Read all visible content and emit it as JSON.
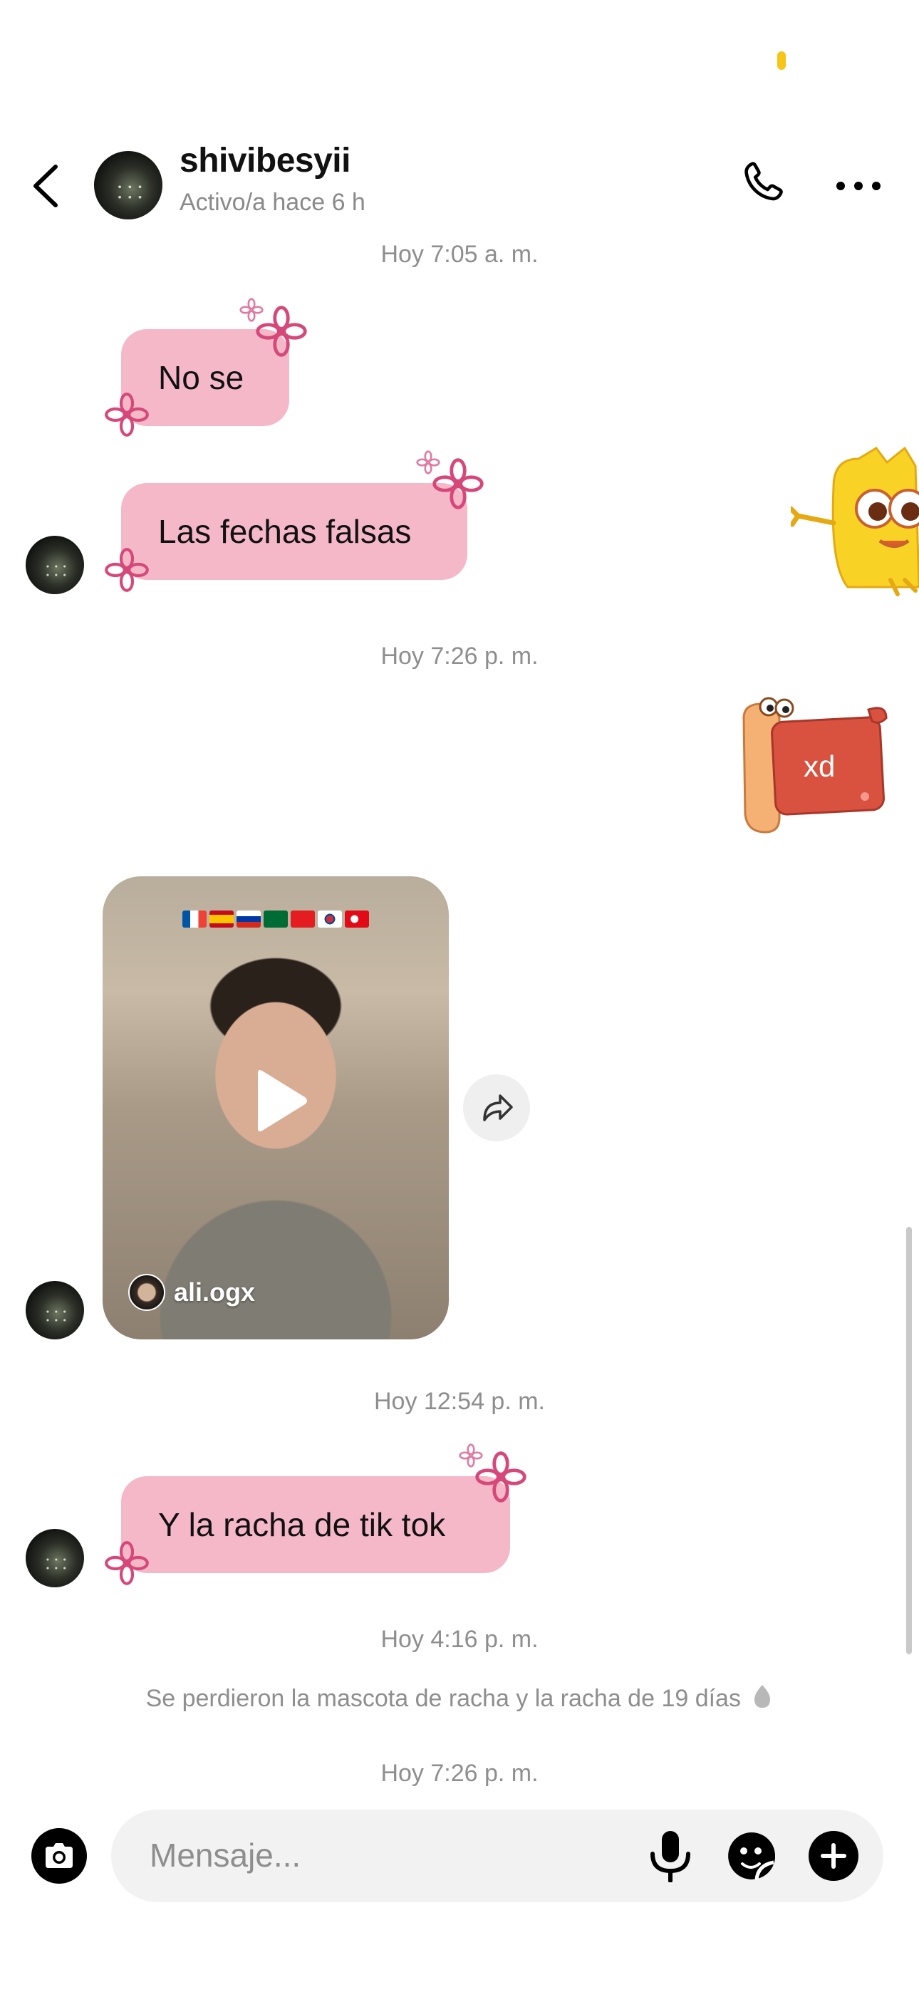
{
  "header": {
    "username": "shivibesyii",
    "activity": "Activo/a hace 6 h"
  },
  "timestamps": {
    "t1": "Hoy 7:05 a. m.",
    "t2": "Hoy 7:26 p. m.",
    "t3": "Hoy 12:54 p. m.",
    "t4": "Hoy 4:16 p. m.",
    "t5": "Hoy 7:26 p. m."
  },
  "messages": {
    "m1": "No se",
    "m2": "Las fechas falsas",
    "m3": "Y la racha de tik tok"
  },
  "sticker": {
    "text": "xd"
  },
  "video": {
    "username": "ali.ogx"
  },
  "system": {
    "streak_lost": "Se perdieron la mascota de racha y la racha de 19 días"
  },
  "composer": {
    "placeholder": "Mensaje..."
  },
  "colors": {
    "bubble": "#f5b8c9",
    "flower": "#d6487a",
    "status_dot": "#f5c518"
  }
}
